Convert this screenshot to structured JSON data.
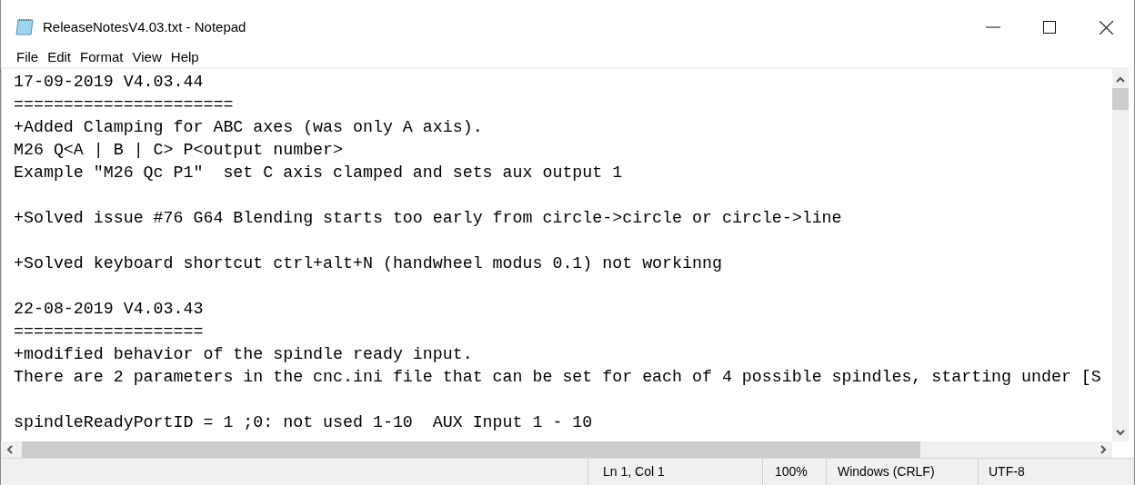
{
  "window": {
    "title": "ReleaseNotesV4.03.txt - Notepad"
  },
  "menu": [
    "File",
    "Edit",
    "Format",
    "View",
    "Help"
  ],
  "editor": {
    "paragraphs": [
      [
        "17-09-2019 V4.03.44",
        "======================",
        "+Added Clamping for ABC axes (was only A axis).",
        "M26 Q<A | B | C> P<output number>",
        "Example \"M26 Qc P1\"  set C axis clamped and sets aux output 1"
      ],
      [
        "+Solved issue #76 G64 Blending starts too early from circle->circle or circle->line"
      ],
      [
        "+Solved keyboard shortcut ctrl+alt+N (handwheel modus 0.1) not workinng"
      ],
      [
        "22-08-2019 V4.03.43",
        "===================",
        "+modified behavior of the spindle ready input.",
        "There are 2 parameters in the cnc.ini file that can be set for each of 4 possible spindles, starting under [S"
      ],
      [
        "spindleReadyPortID = 1 ;0: not used 1-10  AUX Input 1 - 10"
      ]
    ]
  },
  "status_bar": {
    "position": "Ln 1, Col 1",
    "zoom": "100%",
    "line_endings": "Windows (CRLF)",
    "encoding": "UTF-8"
  }
}
